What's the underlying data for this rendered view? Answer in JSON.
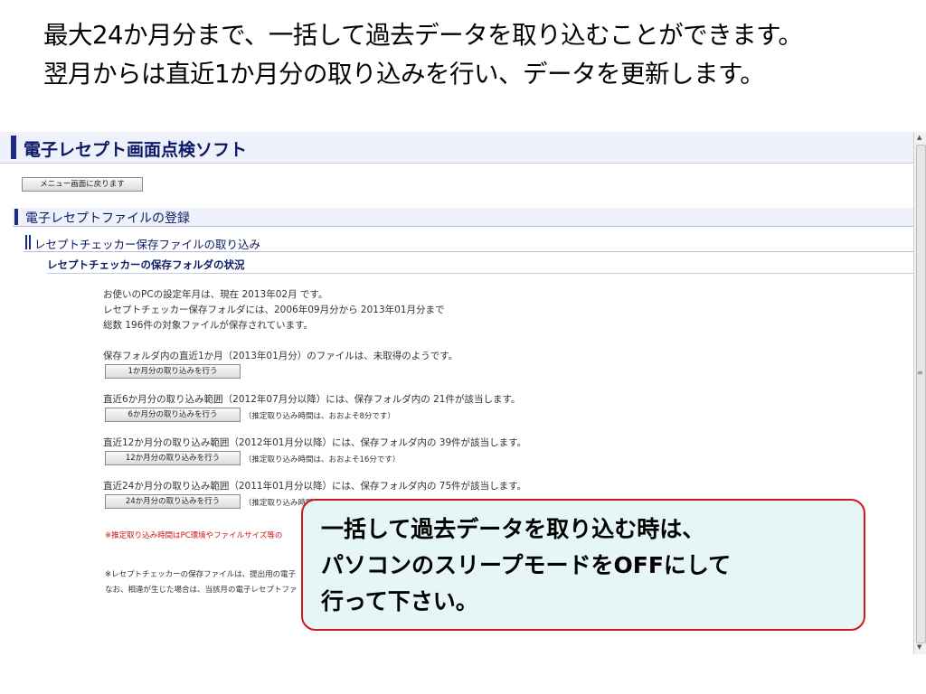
{
  "slide": {
    "heading_lines": [
      "最大24か月分まで、一括して過去データを取り込むことができます。",
      "翌月からは直近1か月分の取り込みを行い、データを更新します。"
    ]
  },
  "app": {
    "title": "電子レセプト画面点検ソフト",
    "menu_button": "メニュー画面に戻ります",
    "section1": "電子レセプトファイルの登録",
    "section2": "レセプトチェッカー保存ファイルの取り込み",
    "section3": "レセプトチェッカーの保存フォルダの状況"
  },
  "status": {
    "line1": "お使いのPCの設定年月は、現在 2013年02月 です。",
    "line2": "レセプトチェッカー保存フォルダには、2006年09月分から 2013年01月分まで",
    "line3": "総数 196件の対象ファイルが保存されています。"
  },
  "imports": [
    {
      "desc": "保存フォルダ内の直近1か月（2013年01月分）のファイルは、未取得のようです。",
      "button": "1か月分の取り込みを行う",
      "estimate": ""
    },
    {
      "desc": "直近6か月分の取り込み範囲（2012年07月分以降）には、保存フォルダ内の 21件が該当します。",
      "button": "6か月分の取り込みを行う",
      "estimate": "（推定取り込み時間は、おおよそ8分です）"
    },
    {
      "desc": "直近12か月分の取り込み範囲（2012年01月分以降）には、保存フォルダ内の 39件が該当します。",
      "button": "12か月分の取り込みを行う",
      "estimate": "（推定取り込み時間は、おおよそ16分です）"
    },
    {
      "desc": "直近24か月分の取り込み範囲（2011年01月分以降）には、保存フォルダ内の 75件が該当します。",
      "button": "24か月分の取り込みを行う",
      "estimate": "（推定取り込み時間"
    }
  ],
  "notes": {
    "red": "※推定取り込み時間はPC環境やファイルサイズ等の",
    "n1": "※レセプトチェッカーの保存ファイルは、提出用の電子",
    "n2": "なお、相違が生じた場合は、当該月の電子レセプトファ"
  },
  "callout": {
    "lines": [
      "一括して過去データを取り込む時は、",
      "パソコンのスリープモードをOFFにして",
      "行って下さい。"
    ]
  },
  "icons": {
    "scroll_up": "scroll-up-arrow",
    "scroll_down": "scroll-down-arrow",
    "grip": "scroll-grip"
  },
  "colors": {
    "title_bar": "#1c2a80",
    "callout_border": "#d4151b",
    "callout_bg": "#e6f5f5",
    "note_red": "#cc1111"
  }
}
